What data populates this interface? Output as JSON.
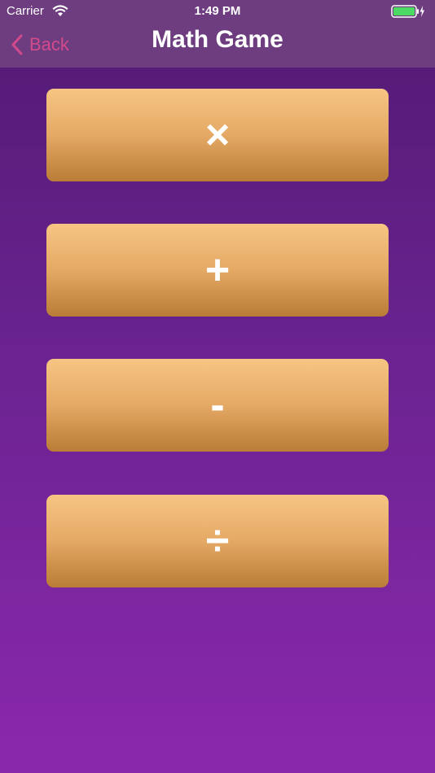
{
  "status": {
    "carrier": "Carrier",
    "time": "1:49 PM"
  },
  "nav": {
    "back_label": "Back",
    "title": "Math Game"
  },
  "operations": [
    {
      "symbol": "×"
    },
    {
      "symbol": "+"
    },
    {
      "symbol": "-"
    },
    {
      "symbol": "÷"
    }
  ],
  "colors": {
    "accent": "#d24a8c",
    "button": "#e4a965",
    "background": "#6a2390"
  }
}
